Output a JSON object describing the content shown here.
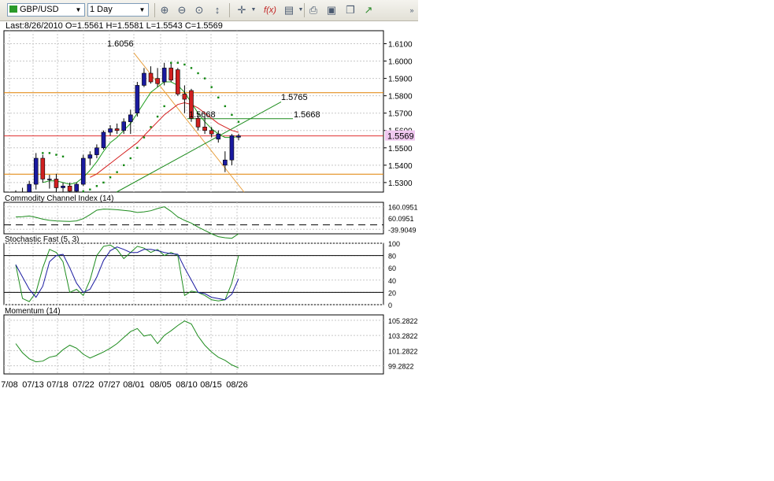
{
  "toolbar": {
    "symbol": "GBP/USD",
    "timeframe": "1 Day",
    "icons": [
      "zoom-in-icon",
      "zoom-out-icon",
      "zoom-fit-icon",
      "scale-icon",
      "crosshair-icon",
      "indicator-fx-icon",
      "calendar-icon",
      "print-icon",
      "save-icon",
      "copy-icon",
      "export-icon"
    ]
  },
  "info_line": "Last:8/26/2010 O=1.5561 H=1.5581 L=1.5543 C=1.5569",
  "chart_data": [
    {
      "type": "candlestick",
      "panel": "price",
      "y_ticks": [
        "1.6100",
        "1.6000",
        "1.5900",
        "1.5800",
        "1.5700",
        "1.5600",
        "1.5500",
        "1.5400",
        "1.5300"
      ],
      "y_range": [
        1.5245,
        1.6175
      ],
      "x_ticks": [
        "7/08",
        "07/13",
        "07/18",
        "07/22",
        "07/27",
        "08/01",
        "08/05",
        "08/10",
        "08/15",
        "08/26"
      ],
      "candles": [
        {
          "o": 1.5195,
          "h": 1.5255,
          "l": 1.516,
          "c": 1.521
        },
        {
          "o": 1.521,
          "h": 1.527,
          "l": 1.519,
          "c": 1.524
        },
        {
          "o": 1.524,
          "h": 1.531,
          "l": 1.522,
          "c": 1.529
        },
        {
          "o": 1.529,
          "h": 1.547,
          "l": 1.526,
          "c": 1.544
        },
        {
          "o": 1.544,
          "h": 1.546,
          "l": 1.53,
          "c": 1.532
        },
        {
          "o": 1.532,
          "h": 1.5345,
          "l": 1.5265,
          "c": 1.532
        },
        {
          "o": 1.532,
          "h": 1.535,
          "l": 1.524,
          "c": 1.527
        },
        {
          "o": 1.527,
          "h": 1.53,
          "l": 1.524,
          "c": 1.528
        },
        {
          "o": 1.528,
          "h": 1.53,
          "l": 1.523,
          "c": 1.525
        },
        {
          "o": 1.525,
          "h": 1.53,
          "l": 1.523,
          "c": 1.529
        },
        {
          "o": 1.529,
          "h": 1.546,
          "l": 1.528,
          "c": 1.544
        },
        {
          "o": 1.544,
          "h": 1.548,
          "l": 1.54,
          "c": 1.546
        },
        {
          "o": 1.546,
          "h": 1.552,
          "l": 1.544,
          "c": 1.55
        },
        {
          "o": 1.55,
          "h": 1.56,
          "l": 1.549,
          "c": 1.559
        },
        {
          "o": 1.559,
          "h": 1.563,
          "l": 1.557,
          "c": 1.561
        },
        {
          "o": 1.561,
          "h": 1.564,
          "l": 1.558,
          "c": 1.56
        },
        {
          "o": 1.56,
          "h": 1.567,
          "l": 1.558,
          "c": 1.565
        },
        {
          "o": 1.565,
          "h": 1.572,
          "l": 1.558,
          "c": 1.569
        },
        {
          "o": 1.57,
          "h": 1.588,
          "l": 1.568,
          "c": 1.586
        },
        {
          "o": 1.586,
          "h": 1.596,
          "l": 1.585,
          "c": 1.593
        },
        {
          "o": 1.593,
          "h": 1.597,
          "l": 1.587,
          "c": 1.588
        },
        {
          "o": 1.59,
          "h": 1.596,
          "l": 1.585,
          "c": 1.587
        },
        {
          "o": 1.588,
          "h": 1.599,
          "l": 1.586,
          "c": 1.596
        },
        {
          "o": 1.596,
          "h": 1.599,
          "l": 1.588,
          "c": 1.589
        },
        {
          "o": 1.595,
          "h": 1.596,
          "l": 1.58,
          "c": 1.581
        },
        {
          "o": 1.581,
          "h": 1.586,
          "l": 1.57,
          "c": 1.578
        },
        {
          "o": 1.583,
          "h": 1.584,
          "l": 1.565,
          "c": 1.567
        },
        {
          "o": 1.567,
          "h": 1.57,
          "l": 1.56,
          "c": 1.562
        },
        {
          "o": 1.562,
          "h": 1.568,
          "l": 1.558,
          "c": 1.56
        },
        {
          "o": 1.56,
          "h": 1.562,
          "l": 1.556,
          "c": 1.558
        },
        {
          "o": 1.555,
          "h": 1.56,
          "l": 1.553,
          "c": 1.558
        },
        {
          "o": 1.54,
          "h": 1.548,
          "l": 1.536,
          "c": 1.543
        },
        {
          "o": 1.543,
          "h": 1.558,
          "l": 1.54,
          "c": 1.557
        },
        {
          "o": 1.5561,
          "h": 1.5581,
          "l": 1.5543,
          "c": 1.5569
        }
      ],
      "sar": [
        1.516,
        1.517,
        1.518,
        1.52,
        1.547,
        1.547,
        1.546,
        1.545,
        1.523,
        1.524,
        1.525,
        1.526,
        1.528,
        1.53,
        1.533,
        1.536,
        1.54,
        1.544,
        1.55,
        1.556,
        1.562,
        1.568,
        1.574,
        1.599,
        1.599,
        1.598,
        1.596,
        1.593,
        1.59,
        1.585,
        1.579,
        1.574,
        1.569,
        1.565
      ],
      "ma_fast": [
        null,
        null,
        null,
        null,
        1.53,
        1.531,
        1.531,
        1.53,
        1.529,
        1.53,
        1.533,
        1.537,
        1.542,
        1.548,
        1.553,
        1.556,
        1.56,
        1.564,
        1.57,
        1.576,
        1.582,
        1.585,
        1.588,
        1.588,
        1.586,
        1.582,
        1.576,
        1.57,
        1.565,
        1.561,
        1.558,
        1.556,
        1.556,
        1.5565
      ],
      "ma_slow": [
        null,
        null,
        null,
        null,
        null,
        null,
        null,
        null,
        null,
        null,
        null,
        1.533,
        1.535,
        1.538,
        1.541,
        1.544,
        1.547,
        1.55,
        1.553,
        1.557,
        1.561,
        1.565,
        1.569,
        1.572,
        1.575,
        1.576,
        1.575,
        1.573,
        1.57,
        1.567,
        1.564,
        1.562,
        1.56,
        1.559
      ],
      "horizontal_lines": [
        {
          "price": 1.5818,
          "color": "#e08000"
        },
        {
          "price": 1.5569,
          "color": "#e03030"
        },
        {
          "price": 1.5348,
          "color": "#e08000"
        }
      ],
      "labels": [
        "1.6056",
        "1.5765",
        "1.5668",
        "1.5668"
      ],
      "last_price_label": "1.5569",
      "colors": {
        "up": "#1a1aa0",
        "down": "#d02020",
        "sar": "#118811",
        "ma_fast": "#1e9e1e",
        "ma_slow": "#d42020",
        "trend": "#e8a040",
        "green_line": "#1e8c1e",
        "last_bg": "#f0c8f0"
      }
    },
    {
      "type": "line",
      "panel": "cci",
      "title": "Commodity Channel Index (14)",
      "y_ticks": [
        "160.0951",
        "60.0951",
        "-39.9049"
      ],
      "y_range": [
        -80,
        200
      ],
      "dashed_level": 0,
      "values": [
        70,
        72,
        78,
        66,
        50,
        40,
        35,
        32,
        30,
        35,
        55,
        90,
        130,
        140,
        138,
        134,
        128,
        122,
        110,
        115,
        125,
        145,
        160,
        120,
        70,
        40,
        15,
        -20,
        -50,
        -80,
        -105,
        -115,
        -120,
        -80
      ],
      "color": "#1e8c1e"
    },
    {
      "type": "line",
      "panel": "stochastic",
      "title": "Stochastic Fast (5, 3)",
      "y_ticks": [
        "100",
        "80",
        "60",
        "40",
        "20",
        "0"
      ],
      "y_range": [
        0,
        100
      ],
      "levels": [
        80,
        20
      ],
      "series": [
        {
          "values": [
            65,
            10,
            5,
            20,
            60,
            90,
            85,
            70,
            20,
            25,
            15,
            40,
            80,
            95,
            97,
            90,
            75,
            85,
            95,
            92,
            85,
            90,
            80,
            85,
            80,
            15,
            22,
            20,
            15,
            8,
            6,
            8,
            35,
            80
          ],
          "color": "#1e8c1e"
        },
        {
          "values": [
            65,
            45,
            25,
            12,
            30,
            70,
            80,
            82,
            60,
            35,
            20,
            25,
            45,
            72,
            88,
            94,
            90,
            85,
            85,
            90,
            90,
            88,
            85,
            83,
            82,
            60,
            40,
            20,
            18,
            12,
            10,
            8,
            17,
            42
          ],
          "color": "#1a1aa0"
        }
      ]
    },
    {
      "type": "line",
      "panel": "momentum",
      "title": "Momentum (14)",
      "y_ticks": [
        "105.2822",
        "103.2822",
        "101.2822",
        "99.2822"
      ],
      "y_range": [
        98.2,
        106.0
      ],
      "values": [
        102.2,
        101.0,
        100.2,
        99.8,
        99.9,
        100.4,
        100.6,
        101.4,
        102.0,
        101.6,
        100.8,
        100.3,
        100.7,
        101.1,
        101.6,
        102.2,
        103.0,
        103.8,
        104.2,
        103.2,
        103.4,
        102.2,
        103.3,
        103.9,
        104.6,
        105.2,
        104.8,
        103.2,
        102.0,
        101.1,
        100.4,
        100.0,
        99.4,
        99.0
      ],
      "color": "#1e8c1e"
    }
  ]
}
